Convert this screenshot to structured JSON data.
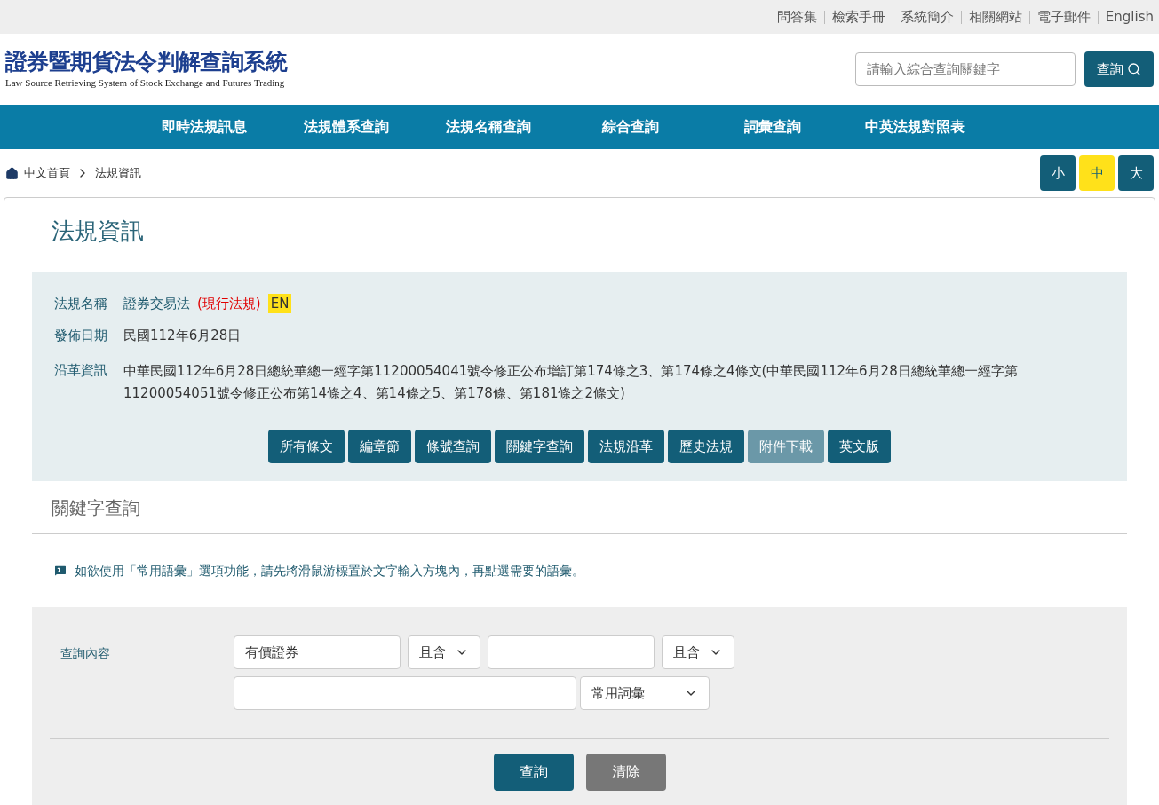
{
  "top_links": [
    "問答集",
    "檢索手冊",
    "系統簡介",
    "相關網站",
    "電子郵件",
    "English"
  ],
  "logo": {
    "title": "證券暨期貨法令判解查詢系統",
    "subtitle": "Law Source Retrieving System of Stock Exchange and Futures Trading"
  },
  "search": {
    "placeholder": "請輸入綜合查詢關鍵字",
    "button": "查詢"
  },
  "nav": [
    "即時法規訊息",
    "法規體系查詢",
    "法規名稱查詢",
    "綜合查詢",
    "詞彙查詢",
    "中英法規對照表"
  ],
  "breadcrumb": [
    "中文首頁",
    "法規資訊"
  ],
  "font_sizes": [
    {
      "label": "小",
      "selected": false
    },
    {
      "label": "中",
      "selected": true
    },
    {
      "label": "大",
      "selected": false
    }
  ],
  "page_title": "法規資訊",
  "info": {
    "name_label": "法規名稱",
    "name": "證券交易法",
    "status": "(現行法規)",
    "en_badge": "EN",
    "date_label": "發佈日期",
    "date": "民國112年6月28日",
    "history_label": "沿革資訊",
    "history": "中華民國112年6月28日總統華總一經字第11200054041號令修正公布增訂第174條之3、第174條之4條文(中華民國112年6月28日總統華總一經字第11200054051號令修正公布第14條之4、第14條之5、第178條、第181條之2條文)"
  },
  "actions": [
    {
      "label": "所有條文",
      "disabled": false
    },
    {
      "label": "編章節",
      "disabled": false
    },
    {
      "label": "條號查詢",
      "disabled": false
    },
    {
      "label": "關鍵字查詢",
      "disabled": false
    },
    {
      "label": "法規沿革",
      "disabled": false
    },
    {
      "label": "歷史法規",
      "disabled": false
    },
    {
      "label": "附件下載",
      "disabled": true
    },
    {
      "label": "英文版",
      "disabled": false
    }
  ],
  "section_title": "關鍵字查詢",
  "tip": "如欲使用「常用語彙」選項功能，請先將滑鼠游標置於文字輸入方塊內，再點選需要的語彙。",
  "form": {
    "label": "查詢內容",
    "keyword1": "有價證券",
    "op1": "且含",
    "op2": "且含",
    "vocab": "常用詞彙",
    "submit": "查詢",
    "clear": "清除"
  }
}
